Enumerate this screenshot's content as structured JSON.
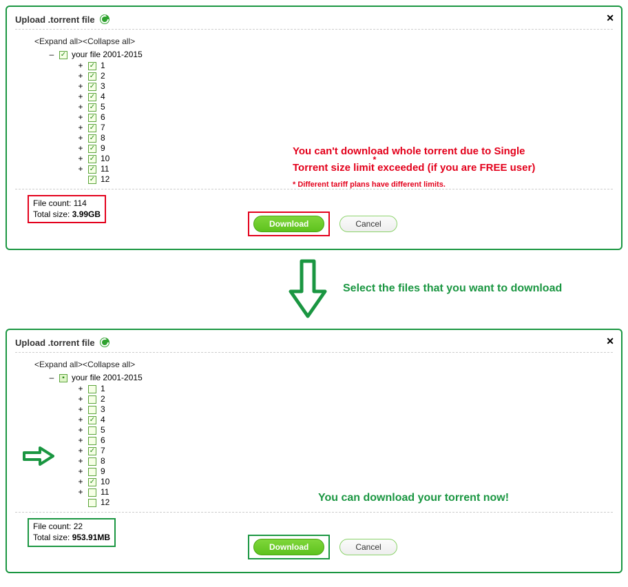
{
  "panel1": {
    "title": "Upload .torrent file",
    "controls": {
      "expand": "<Expand all>",
      "collapse": "<Collapse all>"
    },
    "root_sign": "–",
    "root_label": "your file 2001-2015",
    "root_checked": true,
    "items": [
      {
        "sign": "+",
        "label": "1",
        "checked": true
      },
      {
        "sign": "+",
        "label": "2",
        "checked": true
      },
      {
        "sign": "+",
        "label": "3",
        "checked": true
      },
      {
        "sign": "+",
        "label": "4",
        "checked": true
      },
      {
        "sign": "+",
        "label": "5",
        "checked": true
      },
      {
        "sign": "+",
        "label": "6",
        "checked": true
      },
      {
        "sign": "+",
        "label": "7",
        "checked": true
      },
      {
        "sign": "+",
        "label": "8",
        "checked": true
      },
      {
        "sign": "+",
        "label": "9",
        "checked": true
      },
      {
        "sign": "+",
        "label": "10",
        "checked": true
      },
      {
        "sign": "+",
        "label": "11",
        "checked": true
      },
      {
        "sign": "",
        "label": "12",
        "checked": true
      }
    ],
    "file_count_label": "File count: ",
    "file_count_value": "114",
    "total_size_label": "Total size: ",
    "total_size_value": "3.99GB",
    "download_label": "Download",
    "cancel_label": "Cancel",
    "warn_line1": "You can't download whole torrent due to Single",
    "warn_line2": "Torrent size limit exceeded (if you are FREE user)",
    "warn_asterisk": "*",
    "warn_foot": "* Different tariff plans have different limits."
  },
  "mid": {
    "text": "Select the files that you want to download"
  },
  "panel2": {
    "title": "Upload .torrent file",
    "controls": {
      "expand": "<Expand all>",
      "collapse": "<Collapse all>"
    },
    "root_sign": "–",
    "root_label": "your file 2001-2015",
    "root_checked": "mixed",
    "items": [
      {
        "sign": "+",
        "label": "1",
        "checked": false
      },
      {
        "sign": "+",
        "label": "2",
        "checked": false
      },
      {
        "sign": "+",
        "label": "3",
        "checked": false
      },
      {
        "sign": "+",
        "label": "4",
        "checked": true
      },
      {
        "sign": "+",
        "label": "5",
        "checked": false
      },
      {
        "sign": "+",
        "label": "6",
        "checked": false
      },
      {
        "sign": "+",
        "label": "7",
        "checked": true
      },
      {
        "sign": "+",
        "label": "8",
        "checked": false
      },
      {
        "sign": "+",
        "label": "9",
        "checked": false
      },
      {
        "sign": "+",
        "label": "10",
        "checked": true
      },
      {
        "sign": "+",
        "label": "11",
        "checked": false
      },
      {
        "sign": "",
        "label": "12",
        "checked": false
      }
    ],
    "file_count_label": "File count: ",
    "file_count_value": "22",
    "total_size_label": "Total size: ",
    "total_size_value": "953.91MB",
    "download_label": "Download",
    "cancel_label": "Cancel",
    "ok_msg": "You can download your torrent now!"
  }
}
